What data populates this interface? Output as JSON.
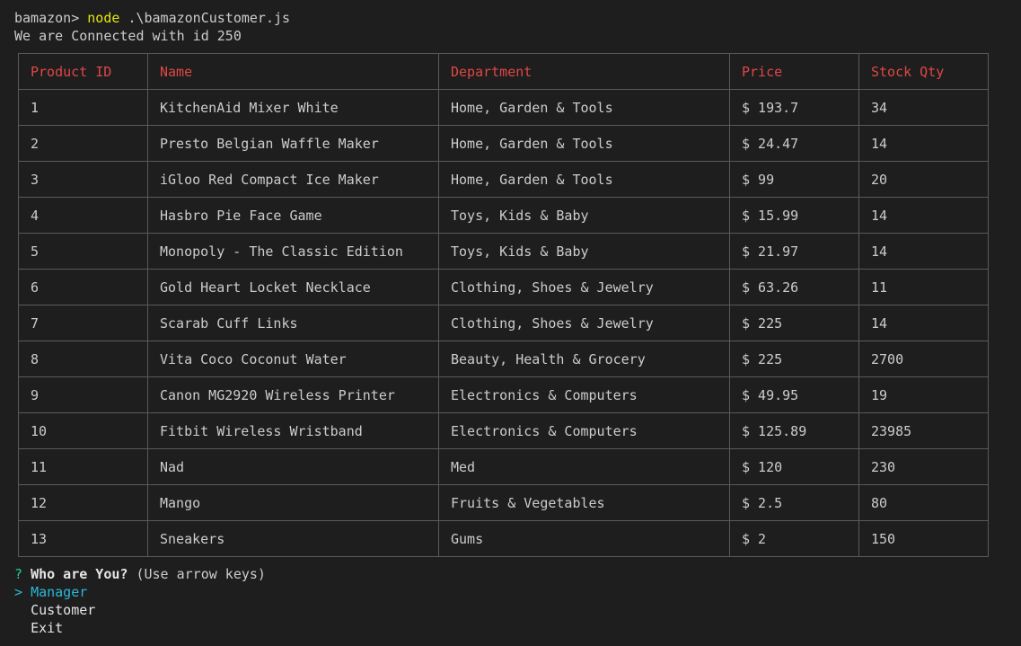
{
  "terminal": {
    "prompt": "bamazon>",
    "command": "node",
    "args": ".\\bamazonCustomer.js",
    "connected_msg": "We are Connected with id 250"
  },
  "table": {
    "headers": [
      "Product ID",
      "Name",
      "Department",
      "Price",
      "Stock Qty"
    ],
    "rows": [
      [
        "1",
        "KitchenAid Mixer White",
        "Home, Garden & Tools",
        "$ 193.7",
        "34"
      ],
      [
        "2",
        "Presto Belgian Waffle Maker",
        "Home, Garden & Tools",
        "$ 24.47",
        "14"
      ],
      [
        "3",
        "iGloo Red Compact Ice Maker",
        "Home, Garden & Tools",
        "$ 99",
        "20"
      ],
      [
        "4",
        "Hasbro Pie Face Game",
        "Toys, Kids & Baby",
        "$ 15.99",
        "14"
      ],
      [
        "5",
        "Monopoly - The Classic Edition",
        "Toys, Kids & Baby",
        "$ 21.97",
        "14"
      ],
      [
        "6",
        "Gold Heart Locket Necklace",
        "Clothing, Shoes & Jewelry",
        "$ 63.26",
        "11"
      ],
      [
        "7",
        "Scarab Cuff Links",
        "Clothing, Shoes & Jewelry",
        "$ 225",
        "14"
      ],
      [
        "8",
        "Vita Coco Coconut Water",
        "Beauty, Health & Grocery",
        "$ 225",
        "2700"
      ],
      [
        "9",
        "Canon MG2920 Wireless Printer",
        "Electronics & Computers",
        "$ 49.95",
        "19"
      ],
      [
        "10",
        "Fitbit Wireless Wristband",
        "Electronics & Computers",
        "$ 125.89",
        "23985"
      ],
      [
        "11",
        "Nad",
        "Med",
        "$ 120",
        "230"
      ],
      [
        "12",
        "Mango",
        "Fruits & Vegetables",
        "$ 2.5",
        "80"
      ],
      [
        "13",
        "Sneakers",
        "Gums",
        "$ 2",
        "150"
      ]
    ]
  },
  "question": {
    "mark": "?",
    "text": "Who are You?",
    "hint": "(Use arrow keys)",
    "pointer": ">",
    "options": [
      "Manager",
      "Customer",
      "Exit"
    ]
  },
  "colors": {
    "background": "#1e1e1e",
    "header_text": "#e04646",
    "command_text": "#e5e510",
    "question_mark": "#23d18b",
    "selected_option": "#29b8db"
  }
}
